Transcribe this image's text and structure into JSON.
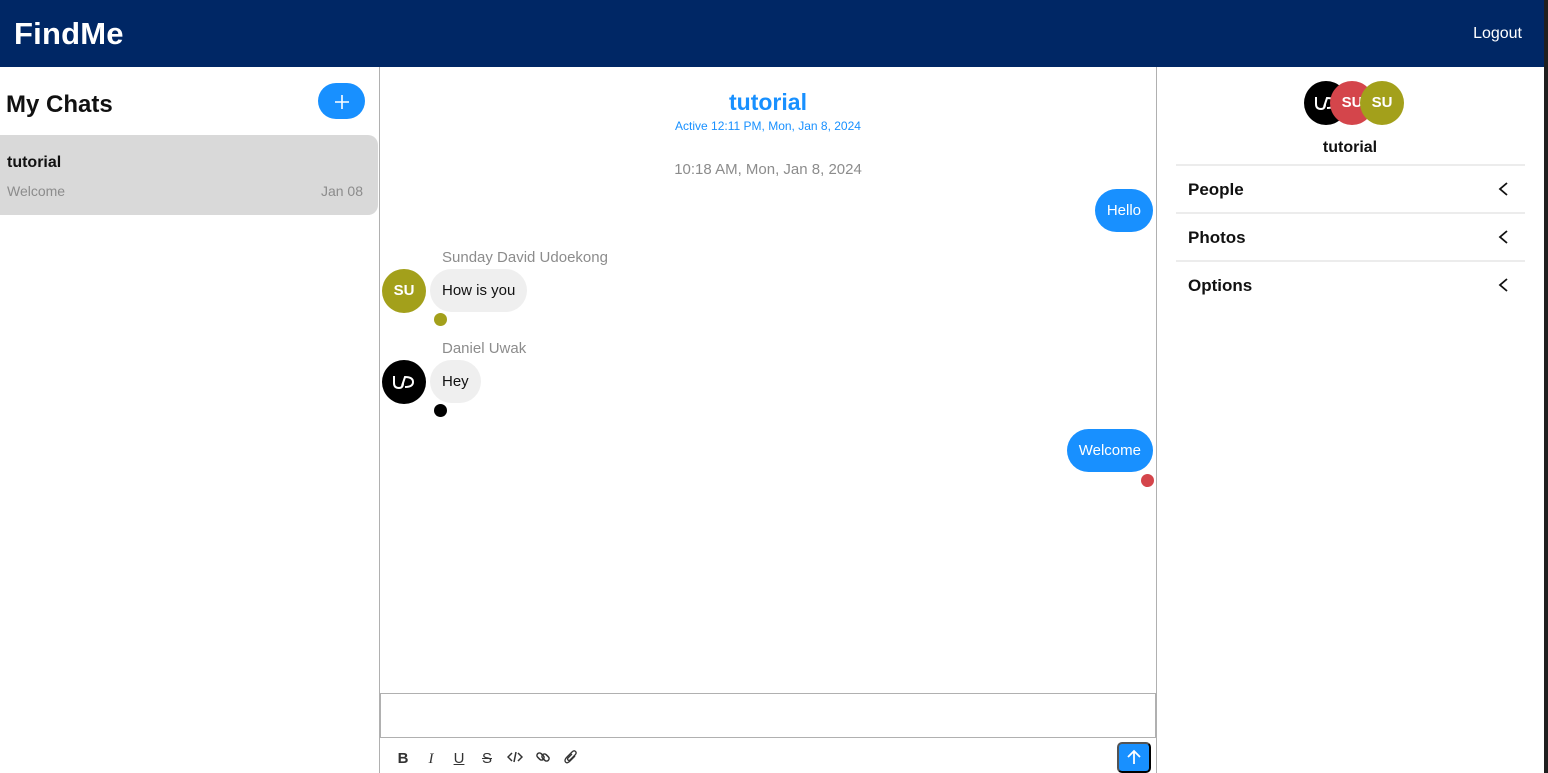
{
  "header": {
    "brand": "FindMe",
    "logout_label": "Logout"
  },
  "sidebar": {
    "title": "My Chats",
    "new_chat_label": "+",
    "chats": [
      {
        "name": "tutorial",
        "last_message": "Welcome",
        "date": "Jan 08"
      }
    ]
  },
  "conversation": {
    "title": "tutorial",
    "active_status": "Active 12:11 PM, Mon, Jan 8, 2024",
    "day_stamp": "10:18 AM, Mon, Jan 8, 2024",
    "messages": [
      {
        "direction": "out",
        "text": "Hello"
      },
      {
        "direction": "in",
        "sender": "Sunday David Udoekong",
        "avatar": "SU",
        "text": "How is you"
      },
      {
        "direction": "in",
        "sender": "Daniel Uwak",
        "avatar": "UD",
        "text": "Hey"
      },
      {
        "direction": "out",
        "text": "Welcome"
      }
    ],
    "composer": {
      "value": "",
      "placeholder": ""
    },
    "toolbar": [
      "bold-icon",
      "italic-icon",
      "underline-icon",
      "strikethrough-icon",
      "code-icon",
      "link-icon",
      "attachment-icon",
      "send-arrow-icon"
    ]
  },
  "details": {
    "avatars": [
      "UD",
      "SU",
      "SU"
    ],
    "group_name": "tutorial",
    "sections": [
      "People",
      "Photos",
      "Options"
    ]
  },
  "colors": {
    "header_bg": "#002765",
    "accent": "#1890ff",
    "avatar_olive": "#a3a01b",
    "avatar_red": "#d4454b",
    "selected_chat_bg": "#d9d9d9"
  }
}
